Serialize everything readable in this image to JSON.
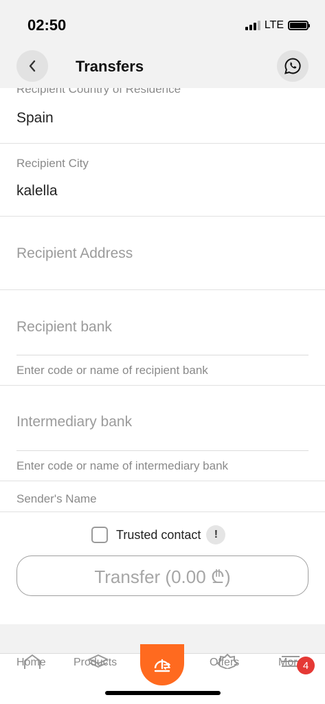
{
  "status_bar": {
    "time": "02:50",
    "network": "LTE",
    "signal_bars_filled": 3,
    "battery_level": 1.0
  },
  "header": {
    "title": "Transfers",
    "back_icon": "chevron-left-icon",
    "action_icon": "whatsapp-icon"
  },
  "form": {
    "country": {
      "label": "Recipient Country of Residence",
      "value": "Spain"
    },
    "city": {
      "label": "Recipient City",
      "value": "kalella"
    },
    "address": {
      "placeholder": "Recipient Address"
    },
    "recipient_bank": {
      "placeholder": "Recipient bank",
      "hint": "Enter code or name of recipient bank"
    },
    "intermediary_bank": {
      "placeholder": "Intermediary bank",
      "hint": "Enter code or name of intermediary bank"
    },
    "sender_name": {
      "label": "Sender's Name"
    }
  },
  "trusted_contact": {
    "label": "Trusted contact",
    "info": "!",
    "checked": false
  },
  "transfer_button": {
    "label": "Transfer (0.00 ₾)"
  },
  "tabbar": {
    "items": [
      {
        "label": "Home",
        "icon": "home-icon"
      },
      {
        "label": "Products",
        "icon": "layers-icon"
      },
      {
        "label": "",
        "icon": "transfer-icon"
      },
      {
        "label": "Offers",
        "icon": "badge-icon"
      },
      {
        "label": "More",
        "icon": "menu-icon"
      }
    ],
    "badge_count": "4"
  },
  "colors": {
    "accent": "#ff6a1f",
    "badge": "#e53935",
    "background": "#f2f2f2"
  }
}
